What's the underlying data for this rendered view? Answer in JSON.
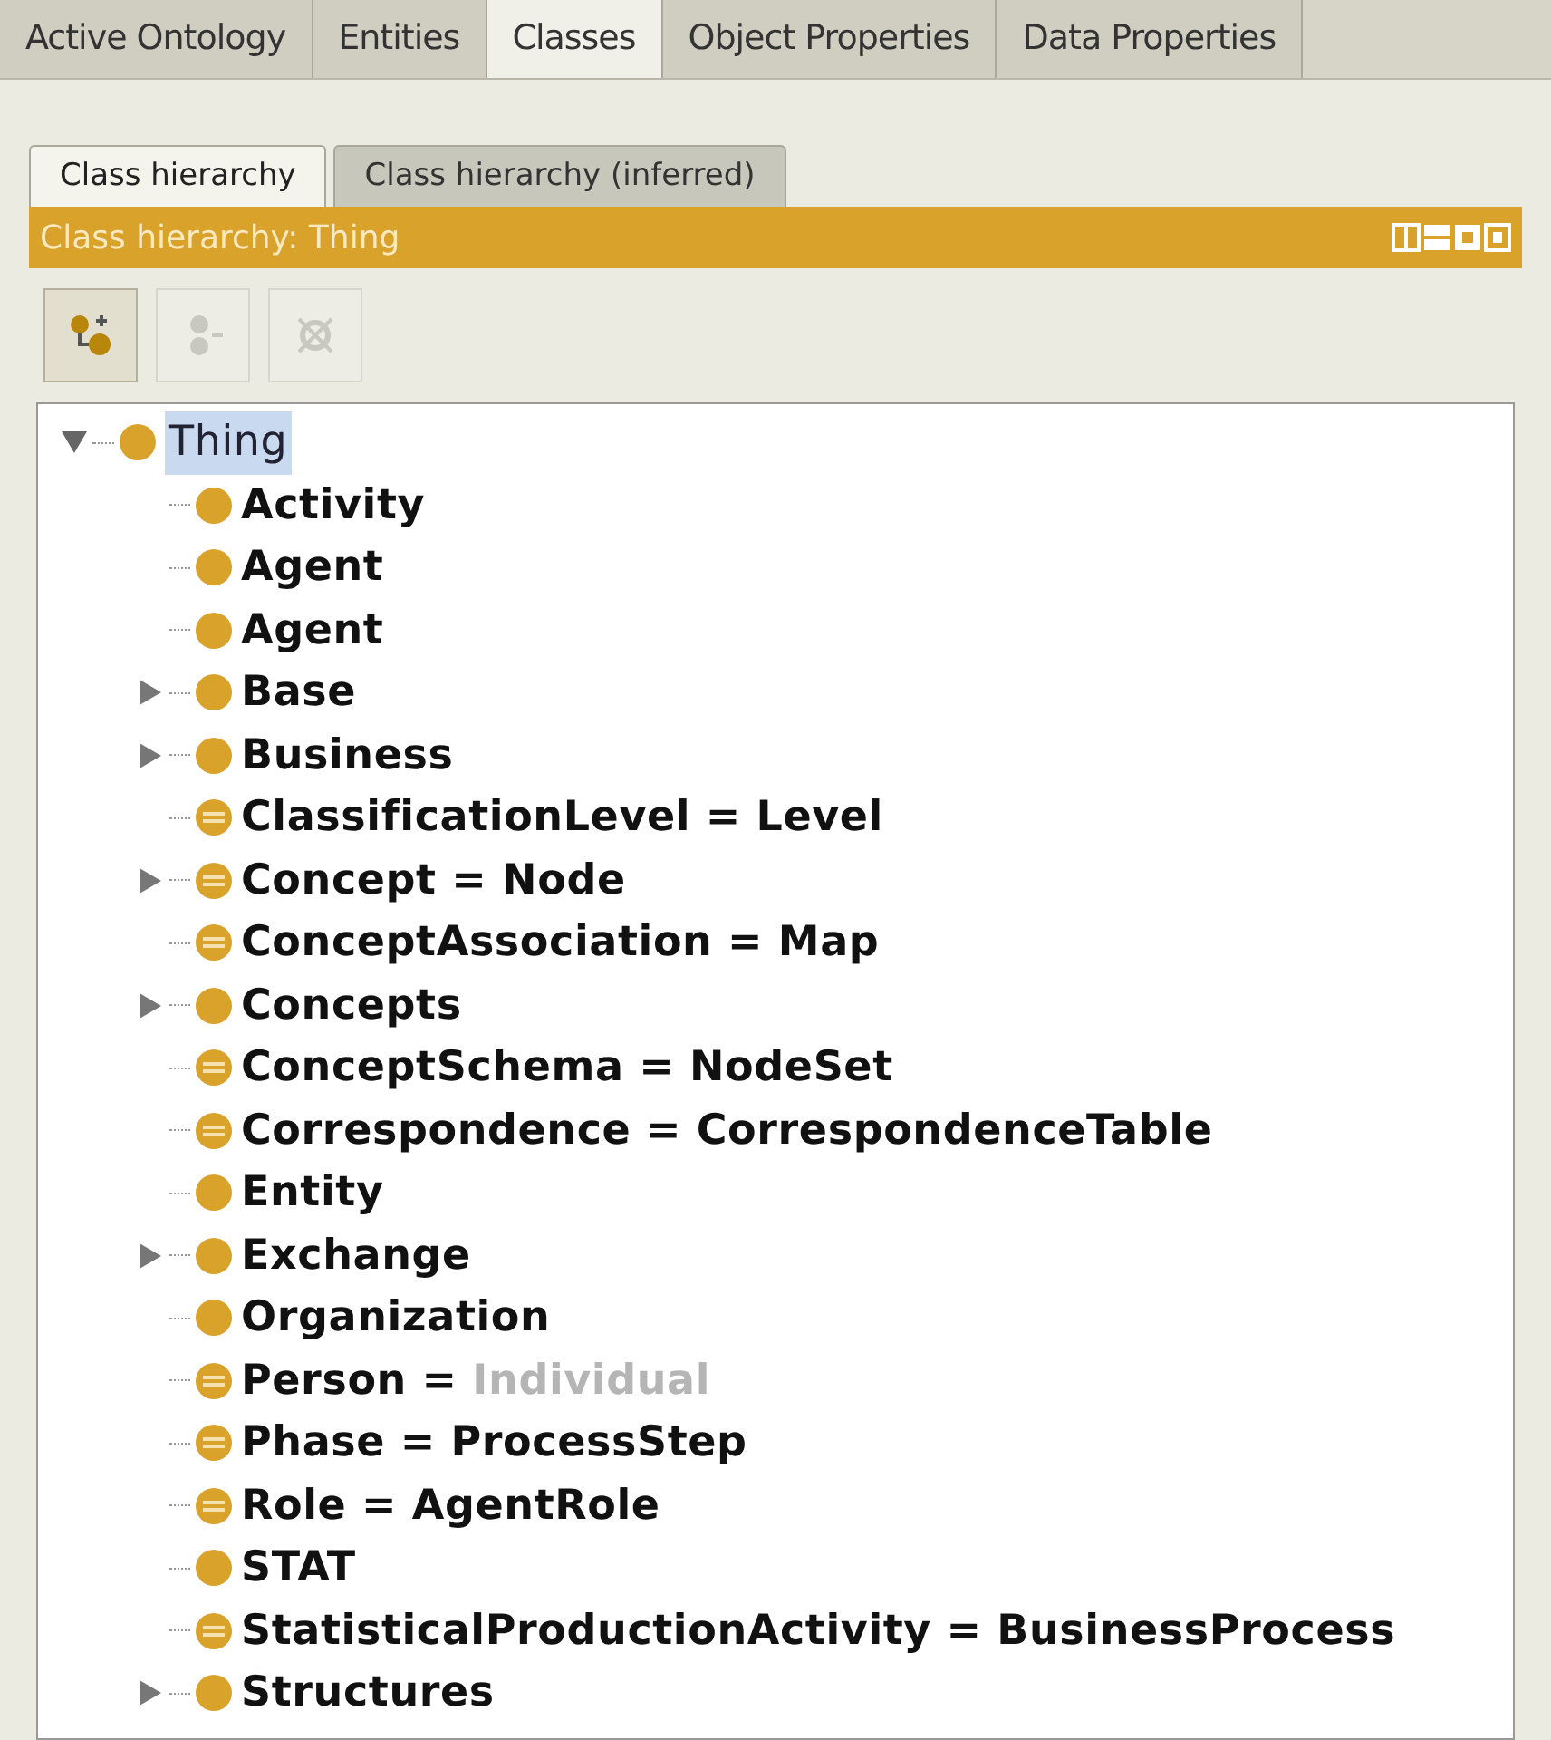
{
  "main_tabs": [
    {
      "label": "Active Ontology",
      "selected": false
    },
    {
      "label": "Entities",
      "selected": false
    },
    {
      "label": "Classes",
      "selected": true
    },
    {
      "label": "Object Properties",
      "selected": false
    },
    {
      "label": "Data Properties",
      "selected": false
    }
  ],
  "view_tabs": [
    {
      "label": "Class hierarchy",
      "selected": true
    },
    {
      "label": "Class hierarchy (inferred)",
      "selected": false
    }
  ],
  "view_title": "Class hierarchy: Thing",
  "toolbar": [
    {
      "kind": "add-subclass",
      "disabled": false
    },
    {
      "kind": "add-sibling",
      "disabled": true
    },
    {
      "kind": "delete",
      "disabled": true
    }
  ],
  "tree": {
    "label": "Thing",
    "kind": "primitive",
    "selected": true,
    "expanded": true,
    "children": [
      {
        "label": "Activity",
        "kind": "primitive"
      },
      {
        "label": "Agent",
        "kind": "primitive"
      },
      {
        "label": "Agent",
        "kind": "primitive"
      },
      {
        "label": "Base",
        "kind": "primitive",
        "expanded": false
      },
      {
        "label": "Business",
        "kind": "primitive",
        "expanded": false
      },
      {
        "label": "ClassificationLevel",
        "kind": "defined",
        "equivalent": {
          "sign": "=",
          "text": "Level",
          "greyed": false
        }
      },
      {
        "label": "Concept",
        "kind": "defined",
        "expanded": false,
        "equivalent": {
          "sign": "=",
          "text": "Node",
          "greyed": false
        }
      },
      {
        "label": "ConceptAssociation",
        "kind": "defined",
        "equivalent": {
          "sign": "=",
          "text": "Map",
          "greyed": false
        }
      },
      {
        "label": "Concepts",
        "kind": "primitive",
        "expanded": false
      },
      {
        "label": "ConceptSchema",
        "kind": "defined",
        "equivalent": {
          "sign": "=",
          "text": "NodeSet",
          "greyed": false
        }
      },
      {
        "label": "Correspondence",
        "kind": "defined",
        "equivalent": {
          "sign": "=",
          "text": "CorrespondenceTable",
          "greyed": false
        }
      },
      {
        "label": "Entity",
        "kind": "primitive"
      },
      {
        "label": "Exchange",
        "kind": "primitive",
        "expanded": false
      },
      {
        "label": "Organization",
        "kind": "primitive"
      },
      {
        "label": "Person",
        "kind": "defined",
        "equivalent": {
          "sign": "=",
          "text": "Individual",
          "greyed": true
        }
      },
      {
        "label": "Phase",
        "kind": "defined",
        "equivalent": {
          "sign": "=",
          "text": "ProcessStep",
          "greyed": false
        }
      },
      {
        "label": "Role",
        "kind": "defined",
        "equivalent": {
          "sign": "=",
          "text": "AgentRole",
          "greyed": false
        }
      },
      {
        "label": "STAT",
        "kind": "primitive"
      },
      {
        "label": "StatisticalProductionActivity",
        "kind": "defined",
        "equivalent": {
          "sign": "=",
          "text": "BusinessProcess",
          "greyed": false
        }
      },
      {
        "label": "Structures",
        "kind": "primitive",
        "expanded": false
      }
    ]
  }
}
